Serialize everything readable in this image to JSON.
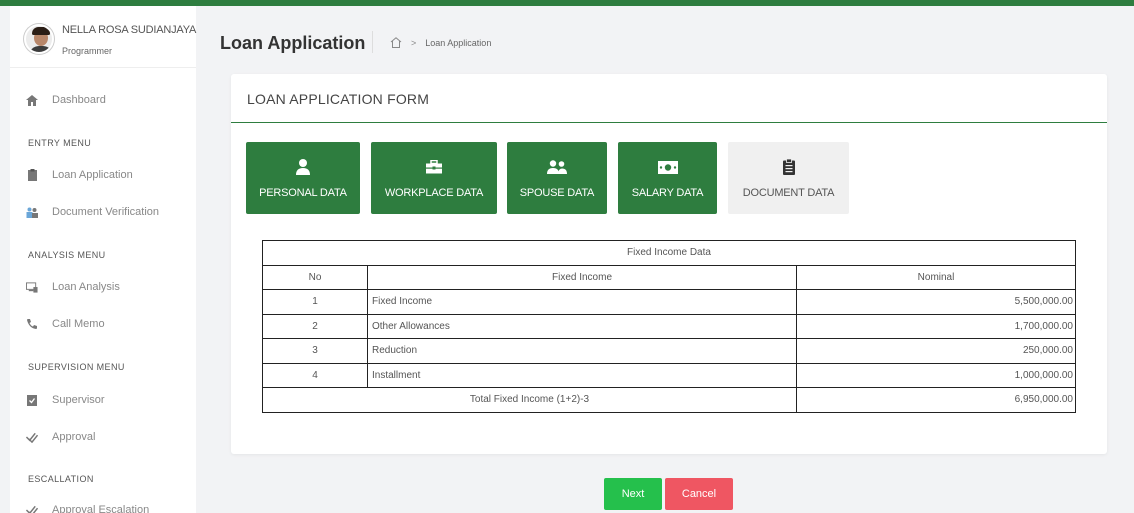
{
  "user": {
    "name": "NELLA ROSA SUDIANJAYA",
    "role": "Programmer"
  },
  "sidebar": {
    "dashboard": "Dashboard",
    "entry_menu": {
      "header": "ENTRY MENU",
      "items": [
        "Loan Application",
        "Document Verification"
      ]
    },
    "analysis_menu": {
      "header": "ANALYSIS MENU",
      "items": [
        "Loan Analysis",
        "Call Memo"
      ]
    },
    "supervision_menu": {
      "header": "SUPERVISION MENU",
      "items": [
        "Supervisor",
        "Approval"
      ]
    },
    "escallation": {
      "header": "ESCALLATION",
      "items": [
        "Approval Escalation"
      ]
    }
  },
  "header": {
    "title": "Loan Application",
    "breadcrumb": "Loan Application"
  },
  "form": {
    "title": "LOAN APPLICATION FORM",
    "tabs": [
      {
        "label": "PERSONAL DATA",
        "icon": "user-icon",
        "active": true
      },
      {
        "label": "WORKPLACE DATA",
        "icon": "briefcase-icon",
        "active": true
      },
      {
        "label": "SPOUSE DATA",
        "icon": "users-icon",
        "active": true
      },
      {
        "label": "SALARY DATA",
        "icon": "money-icon",
        "active": true
      },
      {
        "label": "DOCUMENT DATA",
        "icon": "clipboard-icon",
        "active": false
      }
    ]
  },
  "table": {
    "caption": "Fixed Income Data",
    "headers": [
      "No",
      "Fixed Income",
      "Nominal"
    ],
    "rows": [
      {
        "no": "1",
        "name": "Fixed Income",
        "nominal": "5,500,000.00"
      },
      {
        "no": "2",
        "name": "Other Allowances",
        "nominal": "1,700,000.00"
      },
      {
        "no": "3",
        "name": "Reduction",
        "nominal": "250,000.00"
      },
      {
        "no": "4",
        "name": "Installment",
        "nominal": "1,000,000.00"
      }
    ],
    "total": {
      "label": "Total Fixed Income (1+2)-3",
      "value": "6,950,000.00"
    }
  },
  "buttons": {
    "next": "Next",
    "cancel": "Cancel"
  },
  "colors": {
    "primary": "#2e7d3f",
    "next": "#25c04c",
    "cancel": "#ef5662"
  }
}
